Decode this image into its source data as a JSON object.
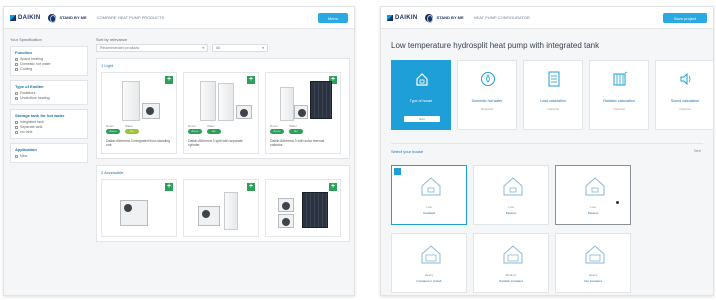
{
  "left": {
    "brand": "DAIKIN",
    "tool_name": "STAND BY ME",
    "tool_sub": "COMPARE HEAT PUMP PRODUCTS",
    "top_button": "Menu",
    "sidebar_title": "Your Specification",
    "filters": [
      {
        "title": "Function",
        "options": [
          "Space heating",
          "Domestic hot water",
          "Cooling"
        ]
      },
      {
        "title": "Type of Emitter",
        "options": [
          "Radiators",
          "Underfloor heating"
        ]
      },
      {
        "title": "Storage tank for hot water",
        "options": [
          "Integrated tank",
          "Separate tank",
          "No tank"
        ]
      },
      {
        "title": "Application",
        "options": [
          "New"
        ]
      }
    ],
    "sort_label": "Sort by relevance",
    "sort_value": "Recommended products",
    "view_value": "All",
    "groups": [
      {
        "title": "1 Light",
        "cards": [
          {
            "rating_label": "Room",
            "season_label": "Water",
            "rating": "A+++",
            "season": "A+",
            "desc": "Daikin Altherma 3 integrated floor-standing unit"
          },
          {
            "rating_label": "Room",
            "season_label": "Water",
            "rating": "A+++",
            "season": "A+",
            "desc": "Daikin Altherma 3 split with separate cylinder"
          },
          {
            "rating_label": "Room",
            "season_label": "Water",
            "rating": "A+++",
            "season": "A+",
            "desc": "Daikin Altherma 3 with solar thermal collector"
          }
        ]
      },
      {
        "title": "2 Accessible",
        "cards": [
          {},
          {},
          {}
        ]
      }
    ]
  },
  "right": {
    "brand": "DAIKIN",
    "tool_name": "STAND BY ME",
    "tool_sub": "HEAT PUMP CONFIGURATOR",
    "top_button": "Save project",
    "title": "Low temperature hydrosplit heat pump with integrated tank",
    "steps": [
      {
        "label": "Type of house",
        "sub": "",
        "button": "Edit"
      },
      {
        "label": "Domestic hot water",
        "sub": "Required"
      },
      {
        "label": "Load calculation",
        "sub": "Optional"
      },
      {
        "label": "Radiator calculation",
        "sub": "Optional"
      },
      {
        "label": "Sound calculation",
        "sub": "Optional"
      }
    ],
    "section_label": "Select your house",
    "section_more": "Next",
    "tiles": [
      {
        "label": "Low",
        "sub": "Insulated"
      },
      {
        "label": "Low",
        "sub": "Passive"
      },
      {
        "label": "Low",
        "sub": "Passive"
      },
      {
        "label": "Heavy",
        "sub": "Insulated or prefab"
      },
      {
        "label": "Medium",
        "sub": "Partially insulated"
      },
      {
        "label": "Heavy",
        "sub": "Not insulated"
      }
    ]
  },
  "colors": {
    "accent": "#1e9fd8",
    "green": "#2ca05a",
    "brand": "#1b2d5c"
  }
}
